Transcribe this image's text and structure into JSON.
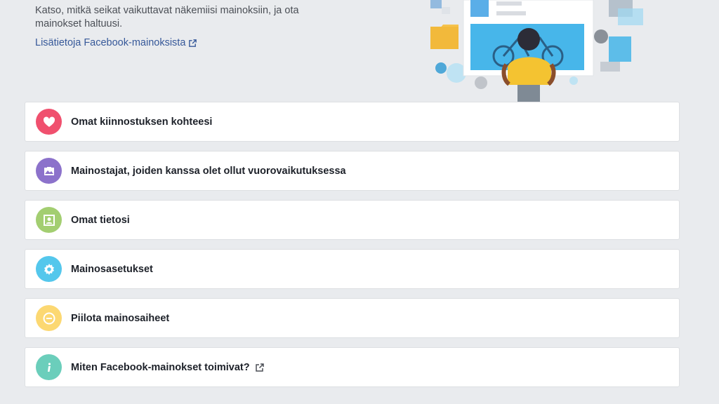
{
  "intro": {
    "text": "Katso, mitkä seikat vaikuttavat näkemiisi mainoksiin, ja ota mainokset haltuusi.",
    "link_label": "Lisätietoja Facebook-mainoksista"
  },
  "sections": [
    {
      "label": "Omat kiinnostuksen kohteesi",
      "icon": "heart-icon",
      "color": "#f0506e"
    },
    {
      "label": "Mainostajat, joiden kanssa olet ollut vuorovaikutuksessa",
      "icon": "briefcase-icon",
      "color": "#8c72cb"
    },
    {
      "label": "Omat tietosi",
      "icon": "profile-icon",
      "color": "#a3ce71"
    },
    {
      "label": "Mainosasetukset",
      "icon": "gear-icon",
      "color": "#54c7ec"
    },
    {
      "label": "Piilota mainosaiheet",
      "icon": "minus-icon",
      "color": "#fcd872"
    },
    {
      "label": "Miten Facebook-mainokset toimivat?",
      "icon": "info-icon",
      "color": "#6bcebb"
    }
  ]
}
